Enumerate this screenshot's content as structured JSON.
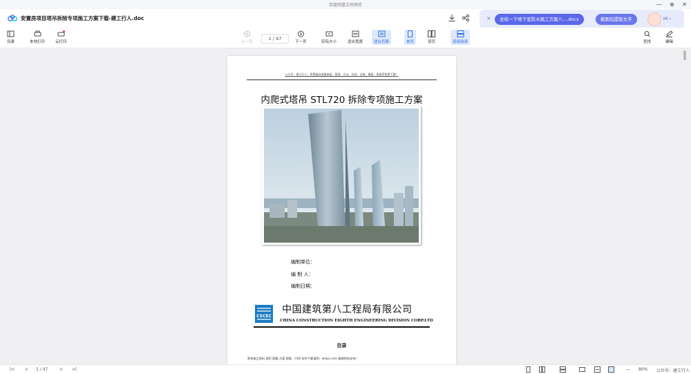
{
  "window": {
    "title": "百度网盘文档预览",
    "controls": [
      "—",
      "⧉",
      "✕"
    ]
  },
  "header": {
    "doc_name": "安置房项目塔吊拆除专项施工方案下载-建工行人.doc",
    "ai_bar": {
      "close": "×",
      "suggestion": "总结一下地下室防水施工方案八....docx",
      "ocr_button": "截图后提取文字",
      "hi": "Hi ›"
    }
  },
  "toolbar": {
    "toc": "目录",
    "local_print": "本地打印",
    "cloud_print": "云打印",
    "prev_page": "上一页",
    "page_indicator": "1 / 47",
    "next_page": "下一页",
    "actual_size": "实际大小",
    "fit_width": "适合宽度",
    "fit_page": "适合页面",
    "single_page": "单页",
    "double_page": "双页",
    "continuous": "连续阅读",
    "search": "查找",
    "edit": "编辑"
  },
  "page": {
    "header_note": "公众号：建工行人；免费精选海量施组、管理、方法、总结、试卷、模板、表格等免费下载！",
    "title": "内爬式塔吊 STL720 拆除专项施工方案",
    "fields": [
      "编制单位：",
      "编  制  人：",
      "编制日期："
    ],
    "company_cn": "中国建筑第八工程局有限公司",
    "company_en": "CHINA CONSTRUCTION EIGHTH ENGINEERING DIVISION CORP.LTD",
    "logo_text": "CSCEC",
    "toc_heading": "目录",
    "footer_note": "更多施工资料 规范 图集 方案 视频、CAD 软件下载请到：wdxjs.com 谢谢你的支持！"
  },
  "statusbar": {
    "first": "|<",
    "prev": "<",
    "page": "1 / 47",
    "next": ">",
    "last": ">|",
    "zoom": "80%",
    "watermark": "公众号：建工行人"
  },
  "colors": {
    "accent": "#5a67e8",
    "active_tab": "#dde8fb",
    "logo_blue": "#1a7bc1"
  }
}
